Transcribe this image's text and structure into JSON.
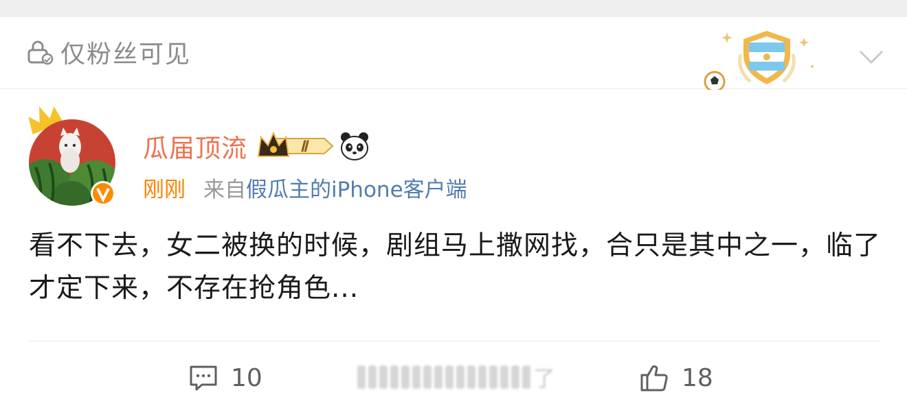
{
  "header": {
    "visibility_label": "仅粉丝可见",
    "lock_icon": "lock-person-icon",
    "badge_icon": "argentina-football-shield-badge",
    "expand_icon": "chevron-down-icon"
  },
  "author": {
    "name": "瓜届顶流",
    "avatar": "cat-with-watermelons-avatar",
    "verified_icon": "orange-v-verified-icon",
    "member_badge": {
      "icon": "crown-vip-icon",
      "level": "Ⅱ"
    },
    "emoji_icon": "panda-face-icon",
    "name_color": "#eb7350"
  },
  "meta": {
    "time": "刚刚",
    "from_prefix": "来自",
    "client": "假瓜主的iPhone客户端"
  },
  "post": {
    "text": "看不下去，女二被换的时候，剧组马上撒网找，合只是其中之一，临了才定下来，不存在抢角色..."
  },
  "actions": {
    "comment": {
      "icon": "comment-icon",
      "count": "10"
    },
    "repost_blurred_char": "了",
    "like": {
      "icon": "thumbs-up-icon",
      "count": "18"
    }
  },
  "colors": {
    "time": "#ff8200",
    "client": "#507daf",
    "muted": "#999999",
    "body": "#1a1a1a"
  }
}
